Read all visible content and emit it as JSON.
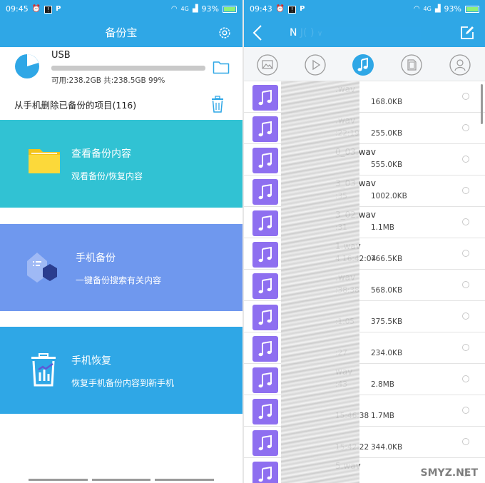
{
  "left_phone": {
    "status": {
      "time": "09:45",
      "network": "4G",
      "battery": "93%",
      "battery_level": 0.93
    },
    "title": "备份宝",
    "usb": {
      "name": "USB",
      "info": "可用:238.2GB 共:238.5GB 99%",
      "used_fraction": 0.99
    },
    "delete_row": {
      "label": "从手机删除已备份的项目(116)"
    },
    "cards": [
      {
        "title": "查看备份内容",
        "subtitle": "观看备份/恢复内容"
      },
      {
        "title": "手机备份",
        "subtitle": "一键备份搜索有关内容"
      },
      {
        "title": "手机恢复",
        "subtitle": "恢复手机备份内容到新手机"
      }
    ]
  },
  "right_phone": {
    "status": {
      "time": "09:43",
      "network": "4G",
      "battery": "93%",
      "battery_level": 0.93
    },
    "title": "N      J(                  )",
    "tabs": [
      {
        "icon": "image-icon",
        "active": false
      },
      {
        "icon": "video-icon",
        "active": false
      },
      {
        "icon": "music-icon",
        "active": true
      },
      {
        "icon": "document-icon",
        "active": false
      },
      {
        "icon": "contact-icon",
        "active": false
      }
    ],
    "files": [
      {
        "name": ".wav",
        "date": "",
        "size": "168.0KB"
      },
      {
        "name": ".wav",
        "date": ":22:19",
        "size": "255.0KB"
      },
      {
        "name": "0_03.wav",
        "date": "",
        "size": "555.0KB"
      },
      {
        "name": "3_03.wav",
        "date": ":35",
        "size": "1002.0KB"
      },
      {
        "name": "3_02.wav",
        "date": ":31",
        "size": "1.1MB"
      },
      {
        "name": "1.wav",
        "date": "4 16:42:04",
        "size": "766.5KB"
      },
      {
        "name": ".wav",
        "date": ":38:38",
        "size": "568.0KB"
      },
      {
        "name": "",
        "date": ":1:05",
        "size": "375.5KB"
      },
      {
        "name": "",
        "date": ":27",
        "size": "234.0KB"
      },
      {
        "name": "wav",
        "date": ":43",
        "size": "2.8MB"
      },
      {
        "name": "",
        "date": "15:46:38",
        "size": "1.7MB"
      },
      {
        "name": "",
        "date": "15:42:22",
        "size": "344.0KB"
      },
      {
        "name": "5.wav",
        "date": "",
        "size": ""
      }
    ]
  },
  "watermark": "SMYZ.NET",
  "colors": {
    "brand": "#2fa7e6",
    "teal": "#31c2d3",
    "periwinkle": "#6f98ee",
    "music_thumb": "#8e6ff0"
  }
}
